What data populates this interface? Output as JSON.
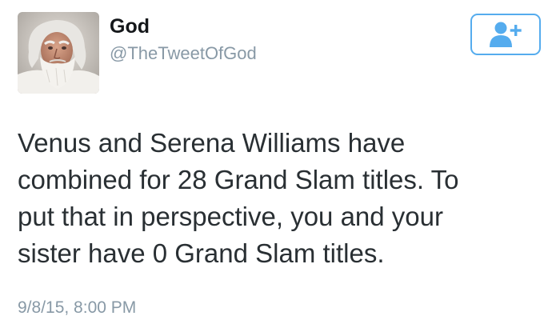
{
  "author": {
    "display_name": "God",
    "handle": "@TheTweetOfGod",
    "avatar_icon": "bearded-man-portrait"
  },
  "follow_button": {
    "icon": "add-user-icon",
    "color": "#55acee"
  },
  "tweet": {
    "text": "Venus and Serena Williams have\ncombined for 28 Grand Slam titles. To\nput that in perspective, you and your\nsister have 0 Grand Slam titles.",
    "timestamp": "9/8/15, 8:00 PM"
  },
  "colors": {
    "text": "#292f33",
    "muted": "#8899a6",
    "accent": "#55acee"
  }
}
